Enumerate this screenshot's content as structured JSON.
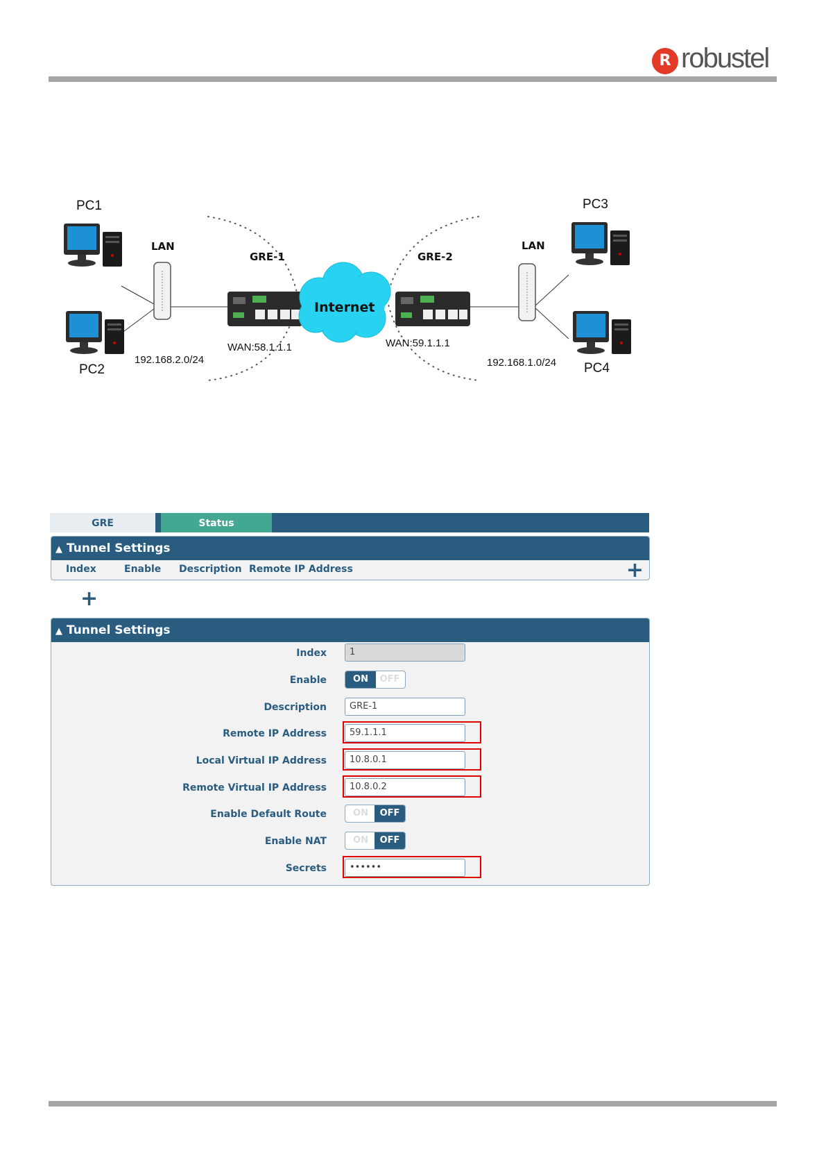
{
  "brand": {
    "logo_mark": "R",
    "logo_text": "robustel"
  },
  "diagram": {
    "pc1": "PC1",
    "pc2": "PC2",
    "pc3": "PC3",
    "pc4": "PC4",
    "lan_left": "LAN",
    "lan_right": "LAN",
    "gre1": "GRE-1",
    "gre2": "GRE-2",
    "internet": "Internet",
    "wan_left": "WAN:58.1.1.1",
    "wan_right": "WAN:59.1.1.1",
    "subnet_left": "192.168.2.0/24",
    "subnet_right": "192.168.1.0/24",
    "colors": {
      "cloud": "#27d3f0",
      "monitor_screen": "#1e90d6",
      "router": "#2b2b2b"
    }
  },
  "tabs": [
    {
      "label": "GRE",
      "active": true
    },
    {
      "label": "Status",
      "active": false
    }
  ],
  "list_panel": {
    "title": "Tunnel Settings",
    "columns": [
      "Index",
      "Enable",
      "Description",
      "Remote IP Address"
    ],
    "add_icon": "plus-icon"
  },
  "form_panel": {
    "title": "Tunnel Settings",
    "fields": {
      "index": {
        "label": "Index",
        "value": "1"
      },
      "enable": {
        "label": "Enable",
        "on": "ON",
        "off": "OFF",
        "state": "on"
      },
      "description": {
        "label": "Description",
        "value": "GRE-1"
      },
      "remote_ip": {
        "label": "Remote IP Address",
        "value": "59.1.1.1"
      },
      "local_virtual_ip": {
        "label": "Local Virtual IP Address",
        "value": "10.8.0.1"
      },
      "remote_virtual_ip": {
        "label": "Remote Virtual IP Address",
        "value": "10.8.0.2"
      },
      "default_route": {
        "label": "Enable Default Route",
        "on": "ON",
        "off": "OFF",
        "state": "off"
      },
      "nat": {
        "label": "Enable NAT",
        "on": "ON",
        "off": "OFF",
        "state": "off"
      },
      "secrets": {
        "label": "Secrets",
        "value": "••••••"
      }
    }
  },
  "colors": {
    "accent": "#2a5c80",
    "status_tab": "#43a891",
    "highlight": "#e00000",
    "rule": "#a6a6a6",
    "brand_red": "#e23a26"
  }
}
